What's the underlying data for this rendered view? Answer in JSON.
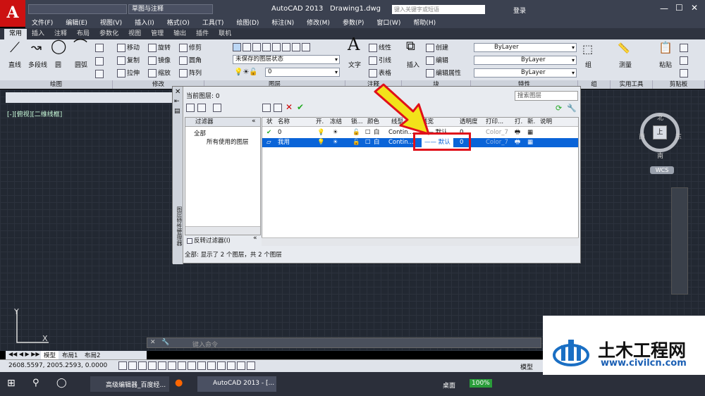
{
  "titlebar": {
    "app_logo": "A",
    "workspace": "草图与注释",
    "app_title": "AutoCAD 2013",
    "file_name": "Drawing1.dwg",
    "search_placeholder": "键入关键字或短语",
    "login": "登录"
  },
  "menu": [
    "文件(F)",
    "编辑(E)",
    "视图(V)",
    "插入(I)",
    "格式(O)",
    "工具(T)",
    "绘图(D)",
    "标注(N)",
    "修改(M)",
    "参数(P)",
    "窗口(W)",
    "帮助(H)"
  ],
  "ribbon_tabs": [
    "常用",
    "插入",
    "注释",
    "布局",
    "参数化",
    "视图",
    "管理",
    "输出",
    "插件",
    "联机"
  ],
  "ribbon": {
    "draw": [
      "直线",
      "多段线",
      "圆",
      "圆弧"
    ],
    "modify": [
      "移动",
      "旋转",
      "修剪",
      "复制",
      "镜像",
      "圆角",
      "拉伸",
      "缩放",
      "阵列"
    ],
    "layer_state": "未保存的图层状态",
    "layer_current": "0",
    "text": "文字",
    "annot": [
      "线性",
      "引线",
      "表格"
    ],
    "block": [
      "插入",
      "创建",
      "编辑",
      "编辑属性"
    ],
    "props": [
      "ByLayer",
      "ByLayer",
      "ByLayer"
    ],
    "groups": [
      "组",
      "测量",
      "粘贴"
    ],
    "panel_titles": [
      "绘图",
      "修改",
      "图层",
      "注释",
      "块",
      "特性",
      "组",
      "实用工具",
      "剪贴板"
    ]
  },
  "viewport": {
    "label": "[-][俯视][二维线框]",
    "compass": {
      "n": "北",
      "s": "南",
      "e": "东",
      "w": "西",
      "center": "上"
    },
    "wcs": "WCS",
    "ucs_x": "X",
    "ucs_y": "Y"
  },
  "dialog": {
    "current_layer": "当前图层: 0",
    "search_placeholder": "搜索图层",
    "filter_header": "过滤器",
    "tree": [
      "全部",
      "所有使用的图层"
    ],
    "invert": "反转过滤器(I)",
    "side_title": "图层特性管理器",
    "columns": [
      "状",
      "名称",
      "开.",
      "冻结",
      "锁...",
      "颜色",
      "线型",
      "线宽",
      "透明度",
      "打印...",
      "打.",
      "新.",
      "说明"
    ],
    "rows": [
      {
        "name": "0",
        "color": "白",
        "linetype": "Contin...",
        "lineweight": "—— 默认",
        "transparency": "0",
        "plot": "Color_7"
      },
      {
        "name": "我用",
        "color": "白",
        "linetype": "Contin...",
        "lineweight": "—— 默认",
        "transparency": "0",
        "plot": "Color_7"
      }
    ],
    "status": "全部: 显示了 2 个图层，共 2 个图层"
  },
  "cmdline": {
    "placeholder": "键入命令"
  },
  "layout_tabs": [
    "模型",
    "布局1",
    "布局2"
  ],
  "status": {
    "coords": "2608.5597, 2005.2593, 0.0000",
    "model": "模型"
  },
  "taskbar": {
    "items": [
      "高级编辑器_百度经...",
      "AutoCAD 2013 - [..."
    ],
    "desktop": "桌面",
    "zoom": "100%"
  },
  "watermark": {
    "title": "土木工程网",
    "url": "www.civilcn.com"
  }
}
